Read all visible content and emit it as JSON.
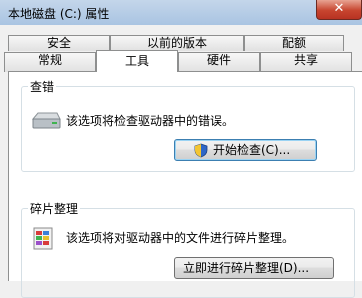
{
  "window": {
    "title": "本地磁盘 (C:) 属性",
    "close_glyph": "✕"
  },
  "tabs": {
    "row1": [
      {
        "label": "安全"
      },
      {
        "label": "以前的版本"
      },
      {
        "label": "配额"
      }
    ],
    "row2": [
      {
        "label": "常规"
      },
      {
        "label": "工具",
        "active": true
      },
      {
        "label": "硬件"
      },
      {
        "label": "共享"
      }
    ]
  },
  "error_check": {
    "group_title": "查错",
    "description": "该选项将检查驱动器中的错误。",
    "icon": "drive-icon",
    "button_label": "开始检查(C)..."
  },
  "defrag": {
    "group_title": "碎片整理",
    "description": "该选项将对驱动器中的文件进行碎片整理。",
    "icon": "defrag-icon",
    "button_label": "立即进行碎片整理(D)..."
  },
  "colors": {
    "accent": "#3c7fb1",
    "close_button": "#c7452f"
  }
}
